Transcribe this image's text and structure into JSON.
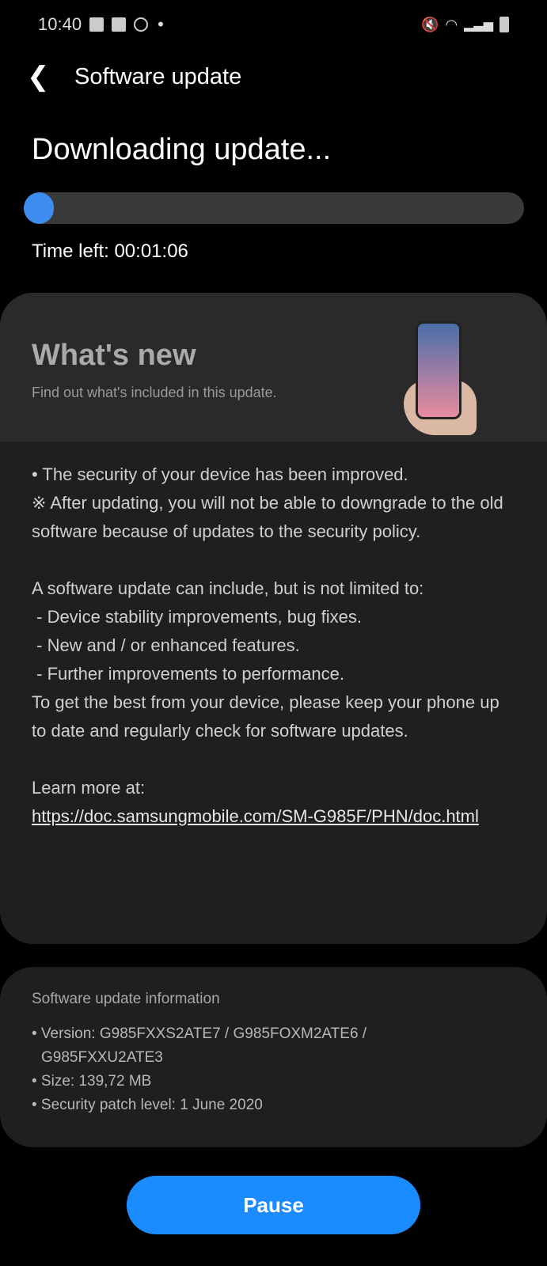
{
  "status_bar": {
    "time": "10:40",
    "icons": [
      "gallery-icon",
      "sync-icon",
      "data-saver-icon",
      "dot-icon",
      "mute-icon",
      "wifi-icon",
      "signal-icon",
      "battery-icon"
    ]
  },
  "header": {
    "title": "Software update"
  },
  "download": {
    "heading": "Downloading update...",
    "progress_percent": 6,
    "time_left": "Time left: 00:01:06"
  },
  "whats_new": {
    "title": "What's new",
    "subtitle": "Find out what's included in this update.",
    "paragraphs": [
      "• The security of your device has been improved.\n※ After updating, you will not be able to downgrade to the old software because of updates to the security policy.",
      "A software update can include, but is not limited to:\n - Device stability improvements, bug fixes.\n - New and / or enhanced features.\n - Further improvements to performance.\nTo get the best from your device, please keep your phone up to date and regularly check for software updates.",
      "Learn more at:"
    ],
    "link": "https://doc.samsungmobile.com/SM-G985F/PHN/doc.html"
  },
  "info": {
    "title": "Software update information",
    "items": [
      "• Version: G985FXXS2ATE7 / G985FOXM2ATE6 / G985FXXU2ATE3",
      "• Size: 139,72 MB",
      "• Security patch level: 1 June 2020"
    ]
  },
  "pause_label": "Pause",
  "colors": {
    "accent": "#1a8cff",
    "progress": "#3d8ef0"
  }
}
